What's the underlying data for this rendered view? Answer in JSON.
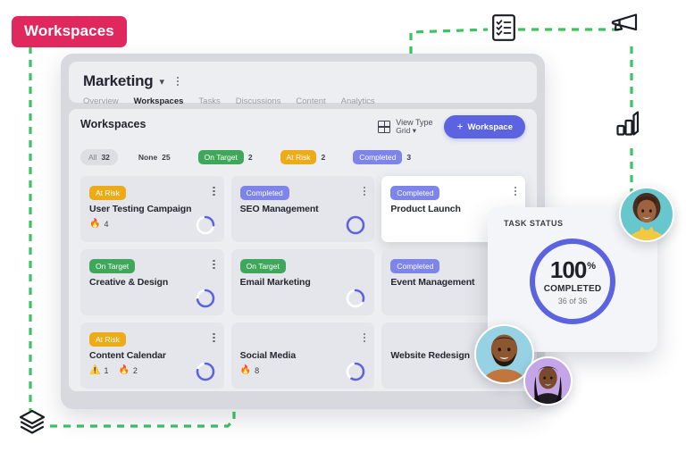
{
  "annotation": {
    "tag_label": "Workspaces"
  },
  "app": {
    "title": "Marketing",
    "title_chevron": "chevron-down",
    "tabs": [
      {
        "label": "Overview",
        "active": false
      },
      {
        "label": "Workspaces",
        "active": true
      },
      {
        "label": "Tasks",
        "active": false
      },
      {
        "label": "Discussions",
        "active": false
      },
      {
        "label": "Content",
        "active": false
      },
      {
        "label": "Analytics",
        "active": false
      }
    ],
    "section_title": "Workspaces",
    "view_type": {
      "label": "View Type",
      "value": "Grid",
      "chevron": "chevron-down"
    },
    "add_button": {
      "plus": "+",
      "label": "Workspace"
    },
    "filters": [
      {
        "label": "All",
        "count": "32",
        "style": "all"
      },
      {
        "label": "None",
        "count": "25",
        "style": "none"
      },
      {
        "label": "On Target",
        "count": "2",
        "style": "ontarget"
      },
      {
        "label": "At Risk",
        "count": "2",
        "style": "atrisk"
      },
      {
        "label": "Completed",
        "count": "3",
        "style": "completed"
      }
    ],
    "cards": [
      {
        "name": "User Testing Campaign",
        "status": "At Risk",
        "status_style": "atrisk",
        "featured": false,
        "show_menu": true,
        "show_ring": true,
        "progress": 25,
        "metrics": [
          {
            "icon": "fire",
            "glyph": "🔥",
            "value": "4"
          }
        ]
      },
      {
        "name": "SEO Management",
        "status": "Completed",
        "status_style": "completed",
        "featured": false,
        "show_menu": true,
        "show_ring": true,
        "progress": 100,
        "metrics": []
      },
      {
        "name": "Product Launch",
        "status": "Completed",
        "status_style": "completed",
        "featured": true,
        "show_menu": true,
        "show_ring": false,
        "progress": 0,
        "metrics": []
      },
      {
        "name": "Creative & Design",
        "status": "On Target",
        "status_style": "ontarget",
        "featured": false,
        "show_menu": true,
        "show_ring": true,
        "progress": 72,
        "metrics": []
      },
      {
        "name": "Email Marketing",
        "status": "On Target",
        "status_style": "ontarget",
        "featured": false,
        "show_menu": false,
        "show_ring": true,
        "progress": 30,
        "metrics": []
      },
      {
        "name": "Event Management",
        "status": "Completed",
        "status_style": "completed",
        "featured": false,
        "show_menu": false,
        "show_ring": false,
        "progress": 0,
        "metrics": []
      },
      {
        "name": "Content Calendar",
        "status": "At Risk",
        "status_style": "atrisk",
        "featured": false,
        "show_menu": true,
        "show_ring": true,
        "progress": 78,
        "metrics": [
          {
            "icon": "warning",
            "glyph": "⚠️",
            "value": "1"
          },
          {
            "icon": "fire",
            "glyph": "🔥",
            "value": "2"
          }
        ]
      },
      {
        "name": "Social Media",
        "status": "",
        "status_style": "",
        "featured": false,
        "show_menu": true,
        "show_ring": true,
        "progress": 58,
        "metrics": [
          {
            "icon": "fire",
            "glyph": "🔥",
            "value": "8"
          }
        ]
      },
      {
        "name": "Website Redesign",
        "status": "",
        "status_style": "",
        "featured": false,
        "show_menu": false,
        "show_ring": false,
        "progress": 0,
        "metrics": []
      }
    ]
  },
  "task_status": {
    "title": "TASK STATUS",
    "percent": "100",
    "percent_symbol": "%",
    "caption": "COMPLETED",
    "detail": "36 of 36",
    "progress": 100
  },
  "decor_icons": [
    {
      "name": "checklist-icon"
    },
    {
      "name": "megaphone-icon"
    },
    {
      "name": "bar-chart-icon"
    },
    {
      "name": "layers-icon"
    }
  ],
  "avatars": [
    {
      "name": "avatar-curly-hair-woman"
    },
    {
      "name": "avatar-bearded-man"
    },
    {
      "name": "avatar-woman-straight-hair"
    }
  ],
  "colors": {
    "accent": "#5b63e0",
    "tag": "#e0285e",
    "on_target": "#3fa75a",
    "at_risk": "#edab18",
    "completed": "#7d84ea",
    "dashed_line": "#3dc362"
  }
}
